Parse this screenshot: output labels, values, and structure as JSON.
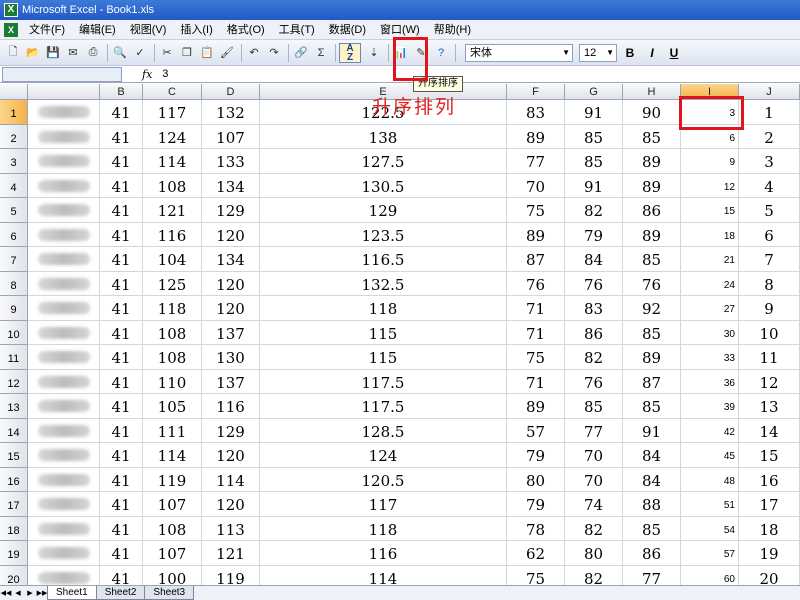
{
  "window": {
    "title": "Microsoft Excel - Book1.xls"
  },
  "menu": [
    "文件(F)",
    "编辑(E)",
    "视图(V)",
    "插入(I)",
    "格式(O)",
    "工具(T)",
    "数据(D)",
    "窗口(W)",
    "帮助(H)"
  ],
  "toolbar": {
    "font": "宋体",
    "size": "12",
    "bold": "B",
    "italic": "I",
    "underline": "U"
  },
  "tooltip": "升序排序",
  "annotation": "升序排列",
  "formula": {
    "fx": "fx",
    "value": "3"
  },
  "columns": [
    "B",
    "C",
    "D",
    "E",
    "F",
    "G",
    "H",
    "I",
    "J"
  ],
  "rows": [
    [
      41,
      117,
      132,
      122.5,
      83,
      91,
      90,
      3,
      1
    ],
    [
      41,
      124,
      107,
      138,
      89,
      85,
      85,
      6,
      2
    ],
    [
      41,
      114,
      133,
      127.5,
      77,
      85,
      89,
      9,
      3
    ],
    [
      41,
      108,
      134,
      130.5,
      70,
      91,
      89,
      12,
      4
    ],
    [
      41,
      121,
      129,
      129,
      75,
      82,
      86,
      15,
      5
    ],
    [
      41,
      116,
      120,
      123.5,
      89,
      79,
      89,
      18,
      6
    ],
    [
      41,
      104,
      134,
      116.5,
      87,
      84,
      85,
      21,
      7
    ],
    [
      41,
      125,
      120,
      132.5,
      76,
      76,
      76,
      24,
      8
    ],
    [
      41,
      118,
      120,
      118,
      71,
      83,
      92,
      27,
      9
    ],
    [
      41,
      108,
      137,
      115,
      71,
      86,
      85,
      30,
      10
    ],
    [
      41,
      108,
      130,
      115,
      75,
      82,
      89,
      33,
      11
    ],
    [
      41,
      110,
      137,
      117.5,
      71,
      76,
      87,
      36,
      12
    ],
    [
      41,
      105,
      116,
      117.5,
      89,
      85,
      85,
      39,
      13
    ],
    [
      41,
      111,
      129,
      128.5,
      57,
      77,
      91,
      42,
      14
    ],
    [
      41,
      114,
      120,
      124,
      79,
      70,
      84,
      45,
      15
    ],
    [
      41,
      119,
      114,
      120.5,
      80,
      70,
      84,
      48,
      16
    ],
    [
      41,
      107,
      120,
      117,
      79,
      74,
      88,
      51,
      17
    ],
    [
      41,
      108,
      113,
      118,
      78,
      82,
      85,
      54,
      18
    ],
    [
      41,
      107,
      121,
      116,
      62,
      80,
      86,
      57,
      19
    ],
    [
      41,
      100,
      119,
      114,
      75,
      82,
      77,
      60,
      20
    ]
  ],
  "sheets": [
    "Sheet1",
    "Sheet2",
    "Sheet3"
  ]
}
